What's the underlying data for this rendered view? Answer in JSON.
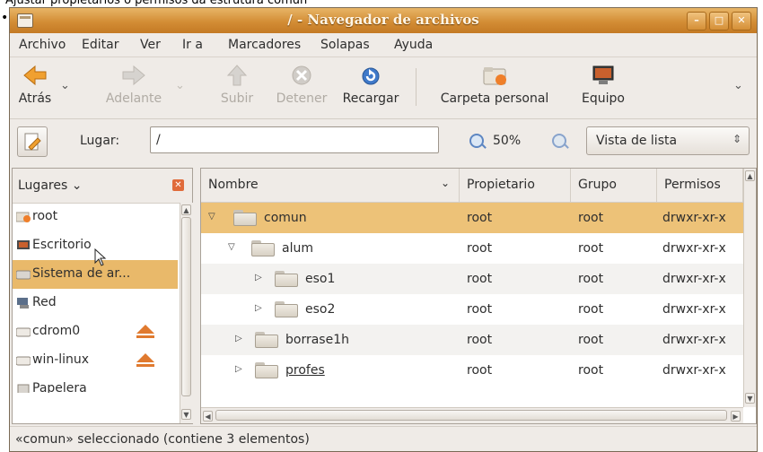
{
  "caption": "Ajustar propietarios o permisos da estrutura común",
  "window": {
    "title": "/ - Navegador de archivos",
    "buttons": {
      "minimize": "–",
      "maximize": "□",
      "close": "✕"
    }
  },
  "menu": [
    "Archivo",
    "Editar",
    "Ver",
    "Ir a",
    "Marcadores",
    "Solapas",
    "Ayuda"
  ],
  "toolbar": {
    "back": "Atrás",
    "forward": "Adelante",
    "up": "Subir",
    "stop": "Detener",
    "reload": "Recargar",
    "home": "Carpeta personal",
    "computer": "Equipo"
  },
  "location": {
    "label": "Lugar:",
    "value": "/",
    "zoom": "50%",
    "view": "Vista de lista"
  },
  "sidebar": {
    "header": "Lugares",
    "items": [
      {
        "label": "root"
      },
      {
        "label": "Escritorio"
      },
      {
        "label": "Sistema de ar..."
      },
      {
        "label": "Red"
      },
      {
        "label": "cdrom0"
      },
      {
        "label": "win-linux"
      },
      {
        "label": "Papelera"
      }
    ]
  },
  "filelist": {
    "columns": {
      "name": "Nombre",
      "owner": "Propietario",
      "group": "Grupo",
      "perms": "Permisos"
    },
    "rows": [
      {
        "name": "comun",
        "owner": "root",
        "group": "root",
        "perms": "drwxr-xr-x"
      },
      {
        "name": "alum",
        "owner": "root",
        "group": "root",
        "perms": "drwxr-xr-x"
      },
      {
        "name": "eso1",
        "owner": "root",
        "group": "root",
        "perms": "drwxr-xr-x"
      },
      {
        "name": "eso2",
        "owner": "root",
        "group": "root",
        "perms": "drwxr-xr-x"
      },
      {
        "name": "borrase1h",
        "owner": "root",
        "group": "root",
        "perms": "drwxr-xr-x"
      },
      {
        "name": "profes",
        "owner": "root",
        "group": "root",
        "perms": "drwxr-xr-x"
      }
    ]
  },
  "status": "«comun» seleccionado (contiene 3 elementos)",
  "colors": {
    "accent": "#d38d35",
    "selection": "#edc278"
  }
}
